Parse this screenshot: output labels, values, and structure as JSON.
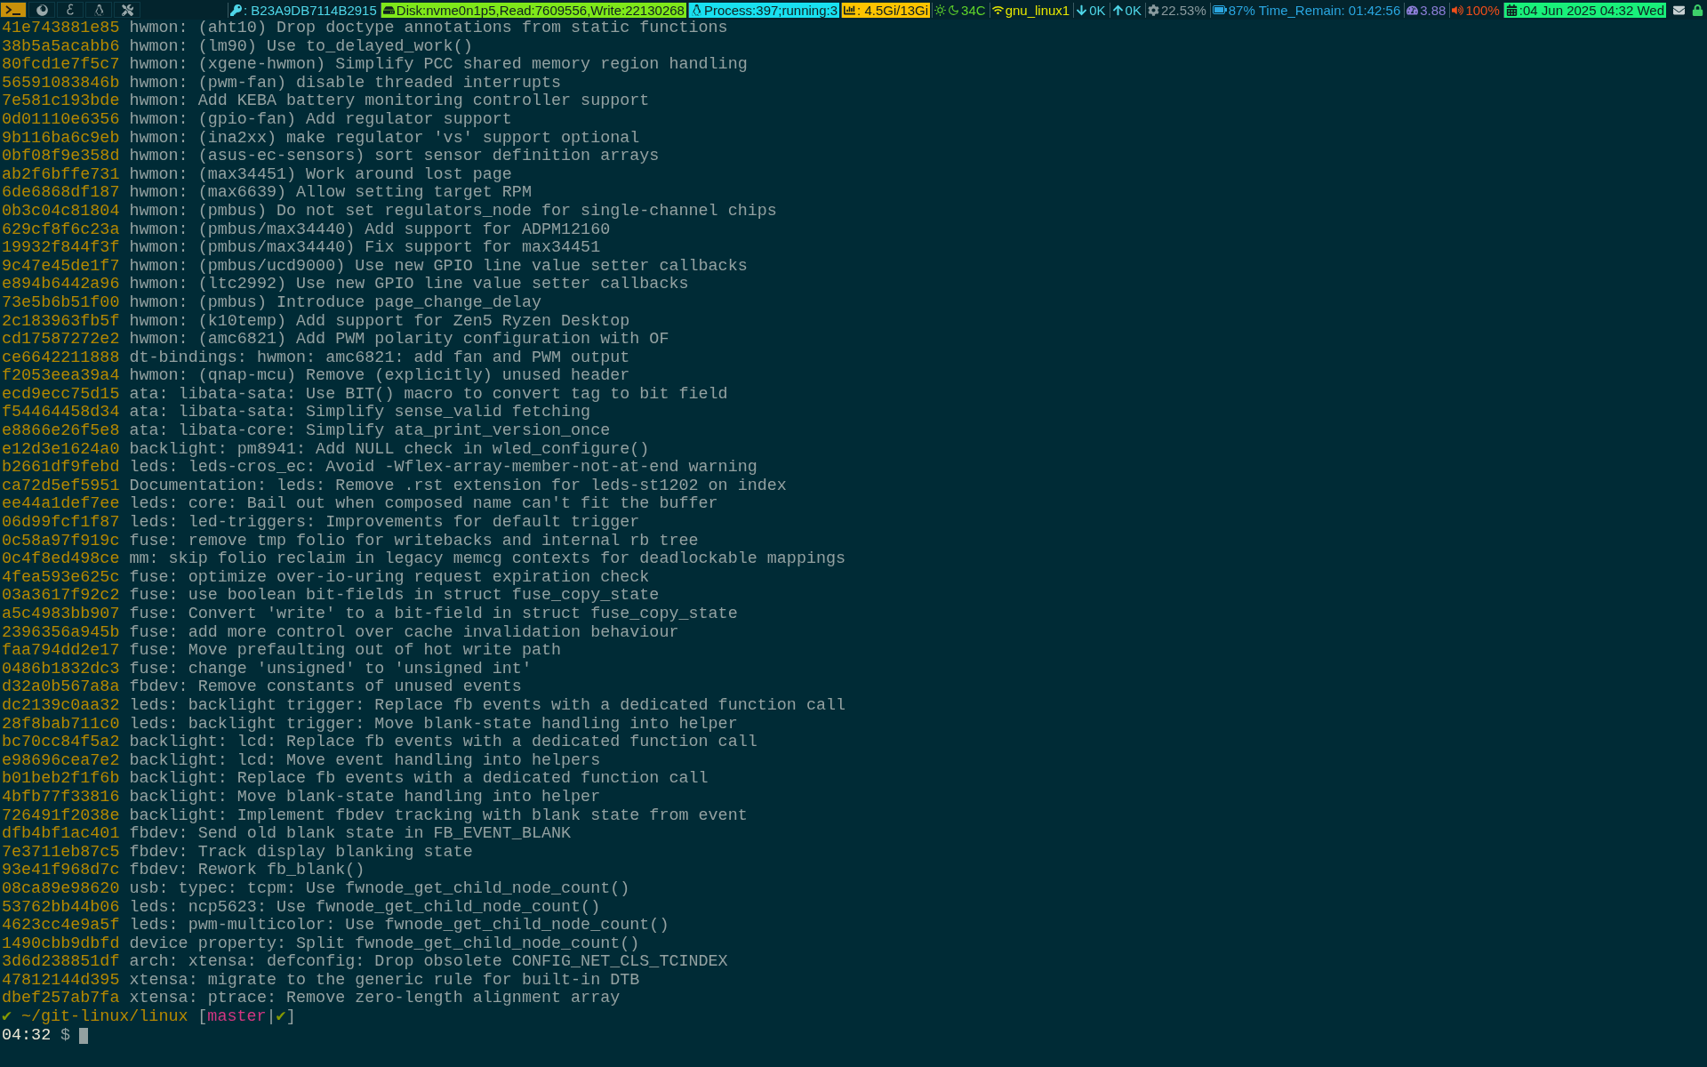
{
  "top_bar": {
    "workspaces": [
      {
        "selected": true
      },
      {
        "selected": false
      },
      {
        "selected": false
      },
      {
        "selected": false
      },
      {
        "selected": false
      }
    ],
    "status": [
      {
        "kind": "plain",
        "color": "#4fd6e8",
        "text": ": B23A9DB7114B2915"
      },
      {
        "kind": "filled",
        "color": "#7fe81a",
        "text": "Disk:nvme0n1p5,Read:7609556,Write:22130268"
      },
      {
        "kind": "filled",
        "color": "#19e0f0",
        "text": "Process:397;running:3"
      },
      {
        "kind": "filled",
        "color": "#ffc400",
        "text": ": 4.5Gi/13Gi"
      },
      {
        "kind": "plain",
        "color": "#5fd32a",
        "text": "34C"
      },
      {
        "kind": "plain",
        "color": "#e6e600",
        "text": "gnu_linux1"
      },
      {
        "kind": "plain",
        "color": "#4fd6e8",
        "text": "0K"
      },
      {
        "kind": "plain",
        "color": "#4fd6e8",
        "text": "0K"
      },
      {
        "kind": "plain",
        "color": "#8a9a9e",
        "text": "22.53%"
      },
      {
        "kind": "plain",
        "color": "#2aa6e0",
        "text": "87% Time_Remain: 01:42:56"
      },
      {
        "kind": "plain",
        "color": "#8d7ed8",
        "text": "3.88"
      },
      {
        "kind": "plain",
        "color": "#f04e1a",
        "text": "100%"
      },
      {
        "kind": "filled",
        "color": "#19f07a",
        "text": ":04 Jun 2025 04:32 Wed"
      }
    ]
  },
  "commits": [
    {
      "hash": "41e743881e85",
      "message": "hwmon: (aht10) Drop doctype annotations from static functions"
    },
    {
      "hash": "38b5a5acabb6",
      "message": "hwmon: (lm90) Use to_delayed_work()"
    },
    {
      "hash": "80fcd1e7f5c7",
      "message": "hwmon: (xgene-hwmon) Simplify PCC shared memory region handling"
    },
    {
      "hash": "56591083846b",
      "message": "hwmon: (pwm-fan) disable threaded interrupts"
    },
    {
      "hash": "7e581c193bde",
      "message": "hwmon: Add KEBA battery monitoring controller support"
    },
    {
      "hash": "0d01110e6356",
      "message": "hwmon: (gpio-fan) Add regulator support"
    },
    {
      "hash": "9b116ba6c9eb",
      "message": "hwmon: (ina2xx) make regulator 'vs' support optional"
    },
    {
      "hash": "0bf08f9e358d",
      "message": "hwmon: (asus-ec-sensors) sort sensor definition arrays"
    },
    {
      "hash": "ab2f6bffe731",
      "message": "hwmon: (max34451) Work around lost page"
    },
    {
      "hash": "6de6868df187",
      "message": "hwmon: (max6639) Allow setting target RPM"
    },
    {
      "hash": "0b3c04c81804",
      "message": "hwmon: (pmbus) Do not set regulators_node for single-channel chips"
    },
    {
      "hash": "629cf8f6c23a",
      "message": "hwmon: (pmbus/max34440) Add support for ADPM12160"
    },
    {
      "hash": "19932f844f3f",
      "message": "hwmon: (pmbus/max34440) Fix support for max34451"
    },
    {
      "hash": "9c47e45de1f7",
      "message": "hwmon: (pmbus/ucd9000) Use new GPIO line value setter callbacks"
    },
    {
      "hash": "e894b6442a96",
      "message": "hwmon: (ltc2992) Use new GPIO line value setter callbacks"
    },
    {
      "hash": "73e5b6b51f00",
      "message": "hwmon: (pmbus) Introduce page_change_delay"
    },
    {
      "hash": "2c183963fb5f",
      "message": "hwmon: (k10temp) Add support for Zen5 Ryzen Desktop"
    },
    {
      "hash": "cd17587272e2",
      "message": "hwmon: (amc6821) Add PWM polarity configuration with OF"
    },
    {
      "hash": "ce6642211888",
      "message": "dt-bindings: hwmon: amc6821: add fan and PWM output"
    },
    {
      "hash": "f2053eea39a4",
      "message": "hwmon: (qnap-mcu) Remove (explicitly) unused header"
    },
    {
      "hash": "ecd9ecc75d15",
      "message": "ata: libata-sata: Use BIT() macro to convert tag to bit field"
    },
    {
      "hash": "f54464458d34",
      "message": "ata: libata-sata: Simplify sense_valid fetching"
    },
    {
      "hash": "e8866e26f5e8",
      "message": "ata: libata-core: Simplify ata_print_version_once"
    },
    {
      "hash": "e12d3e1624a0",
      "message": "backlight: pm8941: Add NULL check in wled_configure()"
    },
    {
      "hash": "b2661df9febd",
      "message": "leds: leds-cros_ec: Avoid -Wflex-array-member-not-at-end warning"
    },
    {
      "hash": "ca72d5ef5951",
      "message": "Documentation: leds: Remove .rst extension for leds-st1202 on index"
    },
    {
      "hash": "ee44a1def7ee",
      "message": "leds: core: Bail out when composed name can't fit the buffer"
    },
    {
      "hash": "06d99fcf1f87",
      "message": "leds: led-triggers: Improvements for default trigger"
    },
    {
      "hash": "0c58a97f919c",
      "message": "fuse: remove tmp folio for writebacks and internal rb tree"
    },
    {
      "hash": "0c4f8ed498ce",
      "message": "mm: skip folio reclaim in legacy memcg contexts for deadlockable mappings"
    },
    {
      "hash": "4fea593e625c",
      "message": "fuse: optimize over-io-uring request expiration check"
    },
    {
      "hash": "03a3617f92c2",
      "message": "fuse: use boolean bit-fields in struct fuse_copy_state"
    },
    {
      "hash": "a5c4983bb907",
      "message": "fuse: Convert 'write' to a bit-field in struct fuse_copy_state"
    },
    {
      "hash": "2396356a945b",
      "message": "fuse: add more control over cache invalidation behaviour"
    },
    {
      "hash": "faa794dd2e17",
      "message": "fuse: Move prefaulting out of hot write path"
    },
    {
      "hash": "0486b1832dc3",
      "message": "fuse: change 'unsigned' to 'unsigned int'"
    },
    {
      "hash": "d32a0b567a8a",
      "message": "fbdev: Remove constants of unused events"
    },
    {
      "hash": "dc2139c0aa32",
      "message": "leds: backlight trigger: Replace fb events with a dedicated function call"
    },
    {
      "hash": "28f8bab711c0",
      "message": "leds: backlight trigger: Move blank-state handling into helper"
    },
    {
      "hash": "bc70cc84f5a2",
      "message": "backlight: lcd: Replace fb events with a dedicated function call"
    },
    {
      "hash": "e98696cea7e2",
      "message": "backlight: lcd: Move event handling into helpers"
    },
    {
      "hash": "b01beb2f1f6b",
      "message": "backlight: Replace fb events with a dedicated function call"
    },
    {
      "hash": "4bfb77f33816",
      "message": "backlight: Move blank-state handling into helper"
    },
    {
      "hash": "726491f2038e",
      "message": "backlight: Implement fbdev tracking with blank state from event"
    },
    {
      "hash": "dfb4bf1ac401",
      "message": "fbdev: Send old blank state in FB_EVENT_BLANK"
    },
    {
      "hash": "7e3711eb87c5",
      "message": "fbdev: Track display blanking state"
    },
    {
      "hash": "93e41f968d7c",
      "message": "fbdev: Rework fb_blank()"
    },
    {
      "hash": "08ca89e98620",
      "message": "usb: typec: tcpm: Use fwnode_get_child_node_count()"
    },
    {
      "hash": "53762bb44b06",
      "message": "leds: ncp5623: Use fwnode_get_child_node_count()"
    },
    {
      "hash": "4623cc4e9a5f",
      "message": "leds: pwm-multicolor: Use fwnode_get_child_node_count()"
    },
    {
      "hash": "1490cbb9dbfd",
      "message": "device property: Split fwnode_get_child_node_count()"
    },
    {
      "hash": "3d6d238851df",
      "message": "arch: xtensa: defconfig: Drop obsolete CONFIG_NET_CLS_TCINDEX"
    },
    {
      "hash": "47812144d395",
      "message": "xtensa: migrate to the generic rule for built-in DTB"
    },
    {
      "hash": "dbef257ab7fa",
      "message": "xtensa: ptrace: Remove zero-length alignment array"
    }
  ],
  "prompt": {
    "status_mark": "✔",
    "path": "~/git-linux/linux",
    "open_bracket": "[",
    "branch": "master",
    "separator": "|",
    "branch_mark": "✔",
    "close_bracket": "]",
    "time": "04:32",
    "symbol": "$"
  }
}
